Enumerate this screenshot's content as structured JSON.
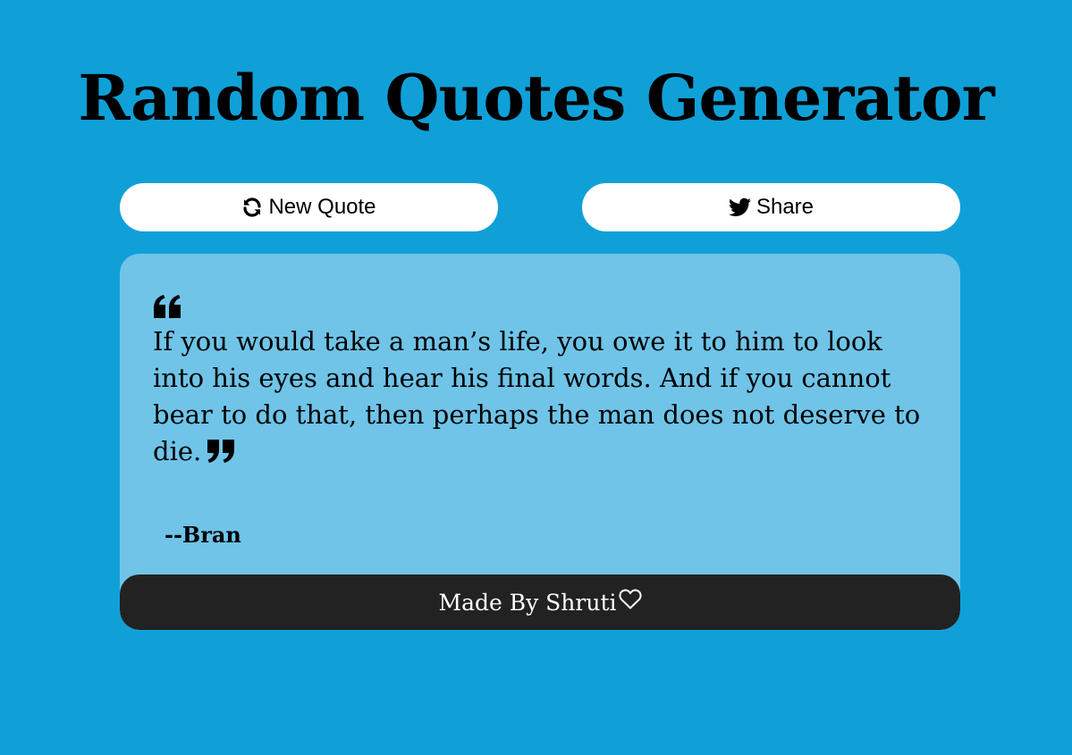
{
  "header": {
    "title": "Random Quotes Generator"
  },
  "toolbar": {
    "new_quote_label": "New Quote",
    "new_quote_icon": "refresh-icon",
    "share_label": "Share",
    "share_icon": "twitter-icon"
  },
  "quote": {
    "text": "If you would take a man’s life, you owe it to him to look into his eyes and hear his final words. And if you cannot bear to do that, then perhaps the man does not deserve to die.",
    "author": "--Bran",
    "open_icon": "quote-left-icon",
    "close_icon": "quote-right-icon"
  },
  "footer": {
    "text": "Made By Shruti",
    "icon": "heart-icon"
  },
  "colors": {
    "background": "#10a0d8",
    "card": "#6fc4e8",
    "footer": "#222222",
    "button": "#ffffff"
  }
}
